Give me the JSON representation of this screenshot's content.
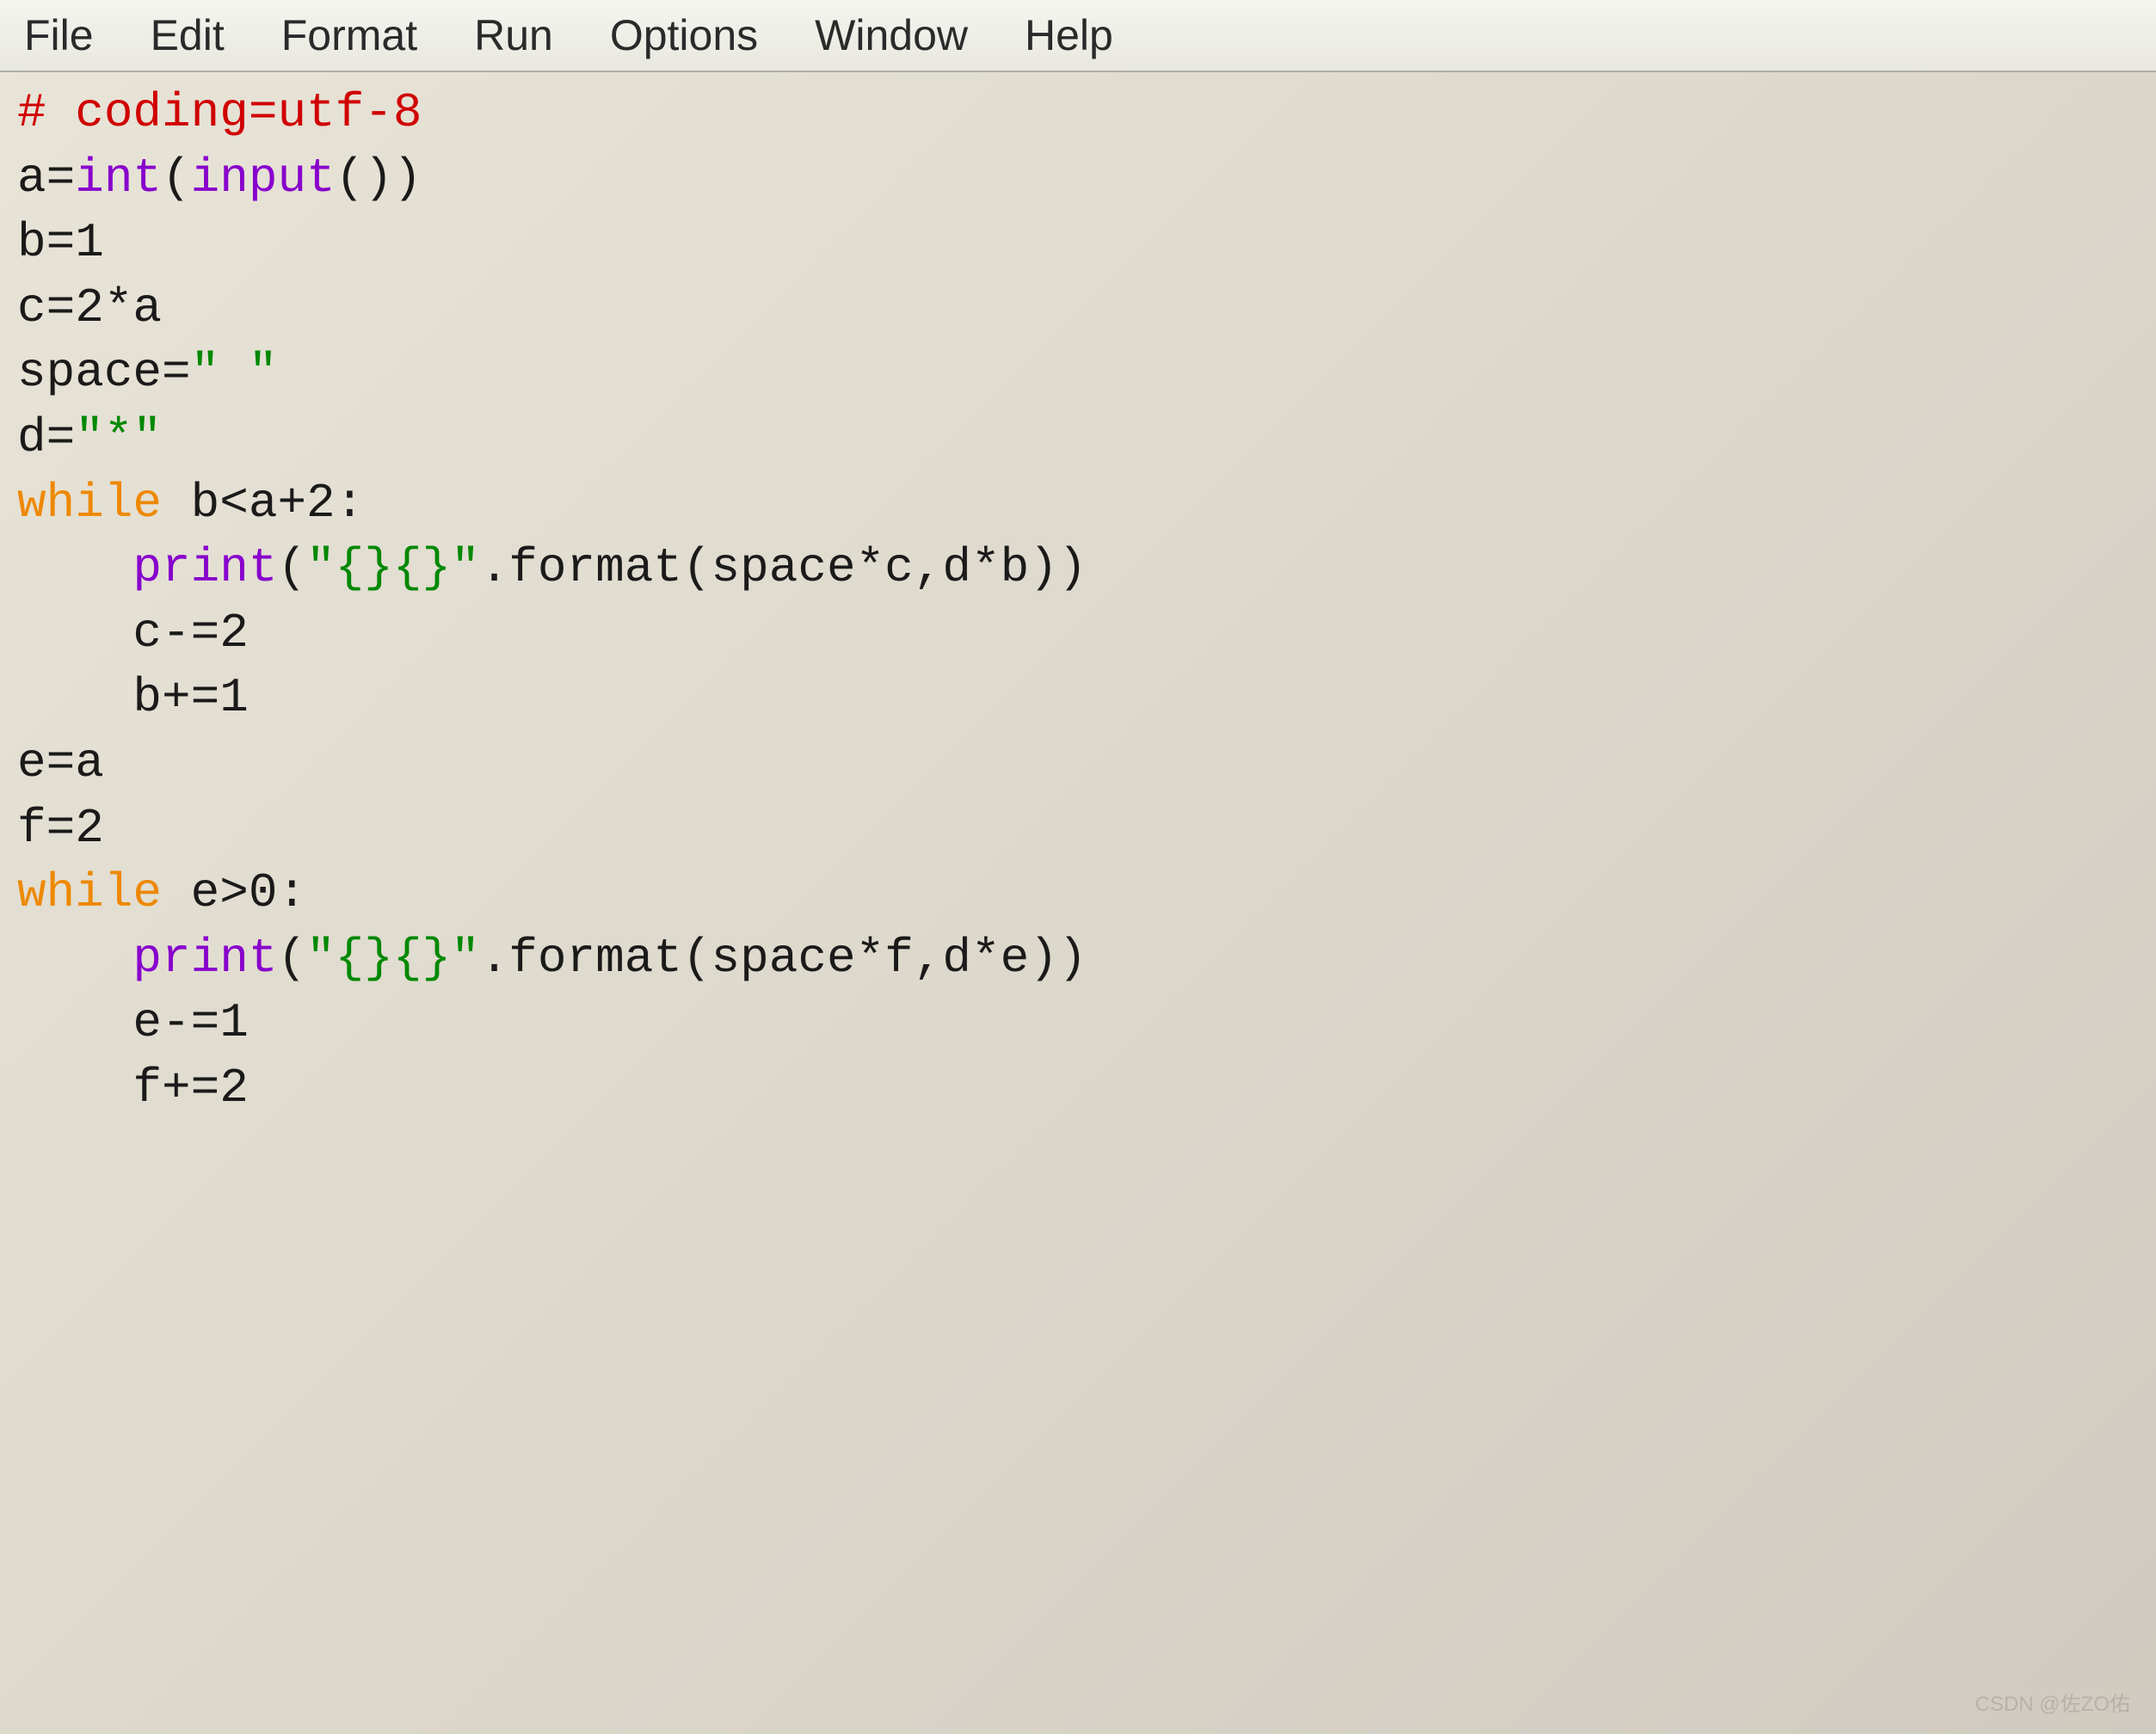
{
  "menubar": {
    "file": "File",
    "edit": "Edit",
    "format": "Format",
    "run": "Run",
    "options": "Options",
    "window": "Window",
    "help": "Help"
  },
  "code": {
    "l1_comment": "# coding=utf-8",
    "l2_a": "a",
    "l2_eq": "=",
    "l2_int": "int",
    "l2_open": "(",
    "l2_input": "input",
    "l2_paren": "()",
    "l2_close": ")",
    "l3": "b=1",
    "l4": "c=2*a",
    "l5_a": "space=",
    "l5_str": "\" \"",
    "l6_a": "d=",
    "l6_str": "\"*\"",
    "l7_while": "while",
    "l7_rest": " b<a+2:",
    "l8_indent": "    ",
    "l8_print": "print",
    "l8_open": "(",
    "l8_str": "\"{}{}\"",
    "l8_rest": ".format(space*c,d*b))",
    "l9": "    c-=2",
    "l10": "    b+=1",
    "l11": "e=a",
    "l12": "f=2",
    "l13_while": "while",
    "l13_rest": " e>0:",
    "l14_indent": "    ",
    "l14_print": "print",
    "l14_open": "(",
    "l14_str": "\"{}{}\"",
    "l14_rest": ".format(space*f,d*e))",
    "l15": "    e-=1",
    "l16": "    f+=2"
  },
  "watermark": "CSDN @佐ZO佑"
}
